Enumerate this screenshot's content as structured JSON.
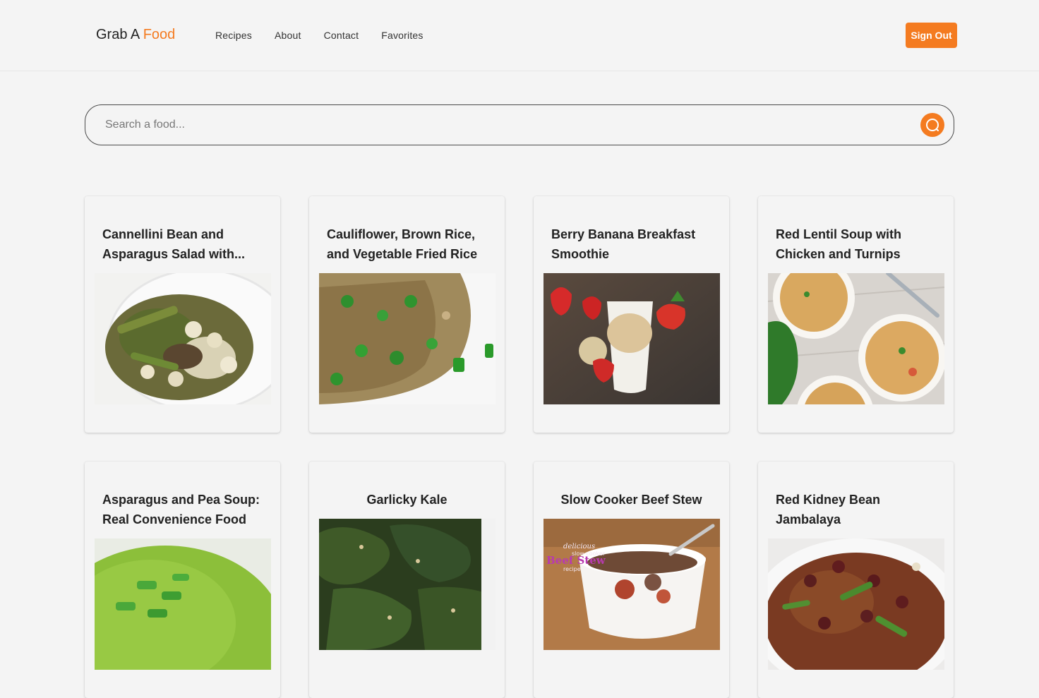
{
  "header": {
    "logo_part1": "Grab A ",
    "logo_part2": "Food",
    "nav": [
      "Recipes",
      "About",
      "Contact",
      "Favorites"
    ],
    "signout_label": "Sign Out",
    "accent_color": "#f47b20"
  },
  "search": {
    "placeholder": "Search a food...",
    "icon": "search-icon"
  },
  "recipes": [
    {
      "title": "Cannellini Bean and Asparagus Salad with..."
    },
    {
      "title": "Cauliflower, Brown Rice, and Vegetable Fried Rice"
    },
    {
      "title": "Berry Banana Breakfast Smoothie"
    },
    {
      "title": "Red Lentil Soup with Chicken and Turnips"
    },
    {
      "title": "Asparagus and Pea Soup: Real Convenience Food"
    },
    {
      "title": "Garlicky Kale"
    },
    {
      "title": "Slow Cooker Beef Stew"
    },
    {
      "title": "Red Kidney Bean Jambalaya"
    }
  ],
  "photo_texts": {
    "beef_stew_line1": "delicious",
    "beef_stew_line2": "slow cooker",
    "beef_stew_line3": "Beef Stew",
    "beef_stew_line4": "recipe"
  }
}
